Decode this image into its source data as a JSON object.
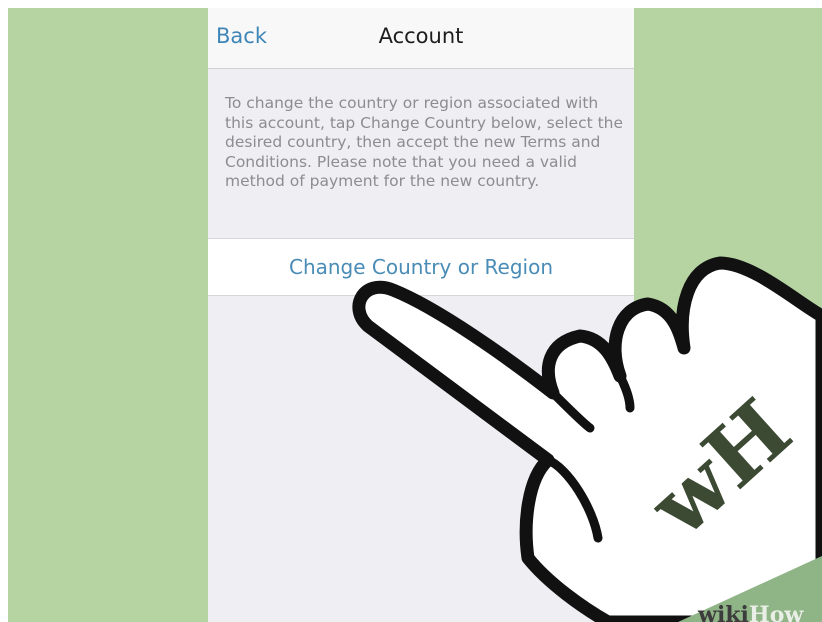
{
  "nav": {
    "back_label": "Back",
    "title": "Account"
  },
  "description": "To change the country or region associated with this account, tap Change Country below, select the desired country, then accept the new Terms and Conditions. Please note that you need a valid method of payment for the new country.",
  "change_button_label": "Change Country or Region",
  "watermark": {
    "monogram": "wH",
    "wiki": "wiki",
    "how": "How"
  },
  "colors": {
    "background_green": "#b6d3a2",
    "link_blue": "#4a8cb6",
    "watermark_dark": "#3c4a34"
  },
  "icons": [
    "pointing-hand-icon",
    "wikihow-logo-icon"
  ]
}
